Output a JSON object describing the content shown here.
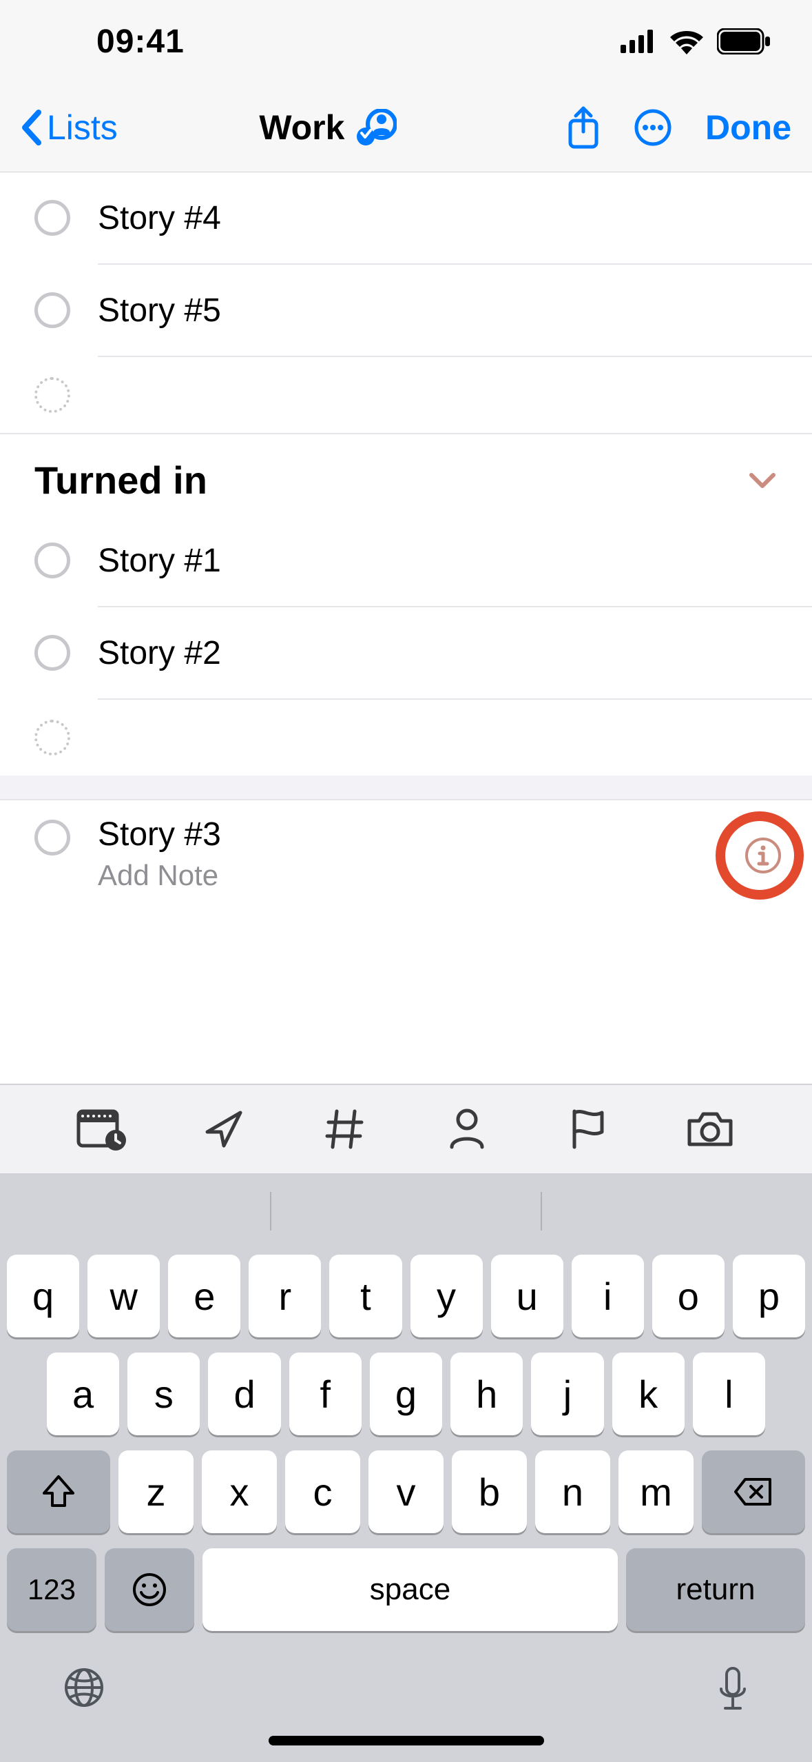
{
  "status": {
    "time": "09:41"
  },
  "nav": {
    "back": "Lists",
    "title": "Work",
    "done": "Done"
  },
  "reminders_top": [
    {
      "title": "Story #4"
    },
    {
      "title": "Story #5"
    }
  ],
  "section": {
    "title": "Turned in"
  },
  "reminders_section": [
    {
      "title": "Story #1"
    },
    {
      "title": "Story #2"
    }
  ],
  "editing": {
    "title": "Story #3",
    "note_placeholder": "Add Note"
  },
  "keyboard": {
    "row1": [
      "q",
      "w",
      "e",
      "r",
      "t",
      "y",
      "u",
      "i",
      "o",
      "p"
    ],
    "row2": [
      "a",
      "s",
      "d",
      "f",
      "g",
      "h",
      "j",
      "k",
      "l"
    ],
    "row3": [
      "z",
      "x",
      "c",
      "v",
      "b",
      "n",
      "m"
    ],
    "num": "123",
    "space": "space",
    "return": "return"
  }
}
